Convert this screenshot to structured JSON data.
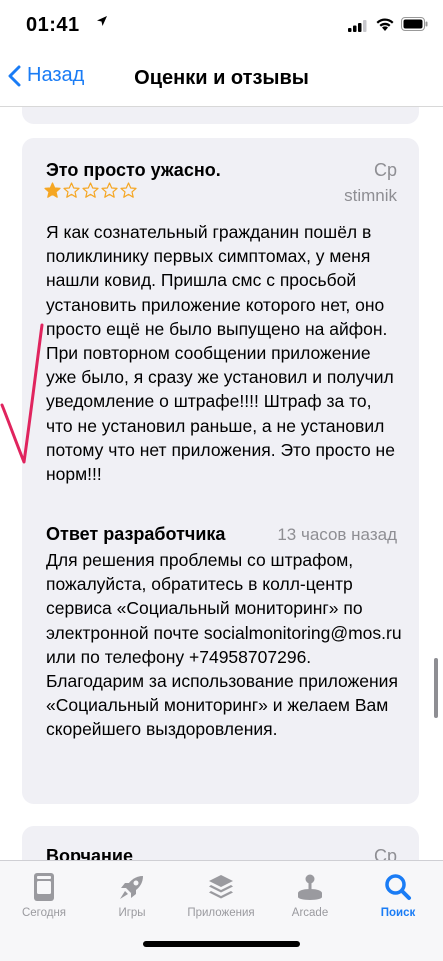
{
  "status": {
    "time": "01:41"
  },
  "nav": {
    "back_label": "Назад",
    "title": "Оценки и отзывы"
  },
  "review": {
    "title": "Это просто ужасно.",
    "date": "Ср",
    "rating": 1,
    "rating_max": 5,
    "author": "stimnik",
    "body": "Я как сознательный гражданин пошёл в поликлинику первых симптомах, у меня нашли ковид. Пришла смс с просьбой установить приложение которого нет, оно просто ещё не было выпущено на айфон. При повторном сообщении приложение уже было, я сразу же установил и получил уведомление о штрафе!!!! Штраф за то, что не установил раньше, а не установил потому что нет приложения. Это просто не норм!!!"
  },
  "developer_response": {
    "title": "Ответ разработчика",
    "time": "13 часов назад",
    "body": "Для решения проблемы со штрафом, пожалуйста, обратитесь в колл-центр сервиса «Социальный мониторинг» по электронной почте socialmonitoring@mos.ru или по телефону +74958707296. Благодарим за использование приложения «Социальный мониторинг» и желаем Вам скорейшего выздоровления."
  },
  "next_review": {
    "title": "Ворчание",
    "date": "Ср"
  },
  "tabs": [
    {
      "label": "Сегодня",
      "icon": "today-icon",
      "active": false
    },
    {
      "label": "Игры",
      "icon": "rocket-icon",
      "active": false
    },
    {
      "label": "Приложения",
      "icon": "apps-stack-icon",
      "active": false
    },
    {
      "label": "Arcade",
      "icon": "arcade-joystick-icon",
      "active": false
    },
    {
      "label": "Поиск",
      "icon": "search-icon",
      "active": true
    }
  ],
  "colors": {
    "accent": "#1a7cf5",
    "star": "#f5a623",
    "card_bg": "#f0f0f5",
    "annotation": "#e0245e"
  }
}
